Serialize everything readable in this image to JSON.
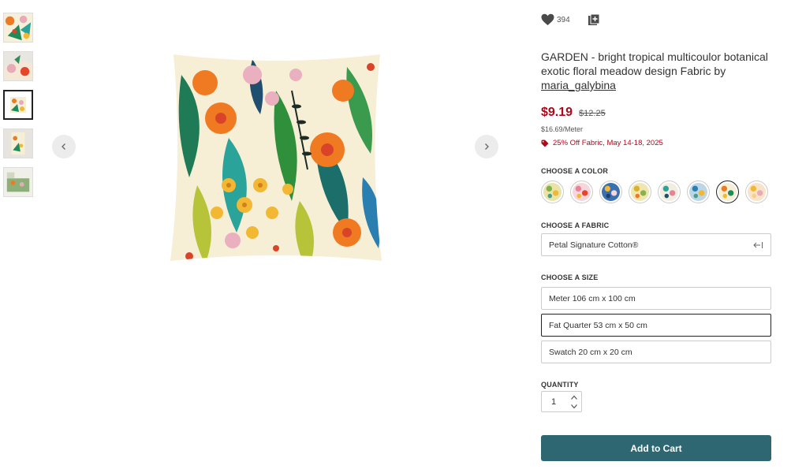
{
  "product": {
    "title": "GARDEN - bright tropical multicoulor botanical exotic floral meadow design Fabric by",
    "designer": "maria_galybina",
    "favorites_count": "394",
    "price": "$9.19",
    "old_price": "$12.25",
    "per_meter": "$16.69/Meter",
    "sale_text": "25% Off Fabric, May 14-18, 2025"
  },
  "thumbnails": [
    {
      "name": "thumbnail-1",
      "active": false
    },
    {
      "name": "thumbnail-2",
      "active": false
    },
    {
      "name": "thumbnail-3",
      "active": true
    },
    {
      "name": "thumbnail-4",
      "active": false
    },
    {
      "name": "thumbnail-5",
      "active": false
    }
  ],
  "color": {
    "label": "CHOOSE A COLOR",
    "selected_index": 6
  },
  "fabric": {
    "label": "CHOOSE A FABRIC",
    "selected": "Petal Signature Cotton®"
  },
  "size": {
    "label": "CHOOSE A SIZE",
    "options": [
      "Meter 106 cm x 100 cm",
      "Fat Quarter 53 cm x 50 cm",
      "Swatch 20 cm x 20 cm"
    ],
    "selected_index": 1
  },
  "quantity": {
    "label": "QUANTITY",
    "value": "1"
  },
  "cart": {
    "button_label": "Add to Cart"
  },
  "colors": {
    "price_red": "#b0081b",
    "button_teal": "#2e6771"
  },
  "icons": {
    "favorite": "heart-icon",
    "collection": "add-to-collection-icon",
    "sale": "tag-icon",
    "prev": "chevron-left-icon",
    "next": "chevron-right-icon",
    "fabric_dropdown": "arrow-left-bar-icon"
  }
}
